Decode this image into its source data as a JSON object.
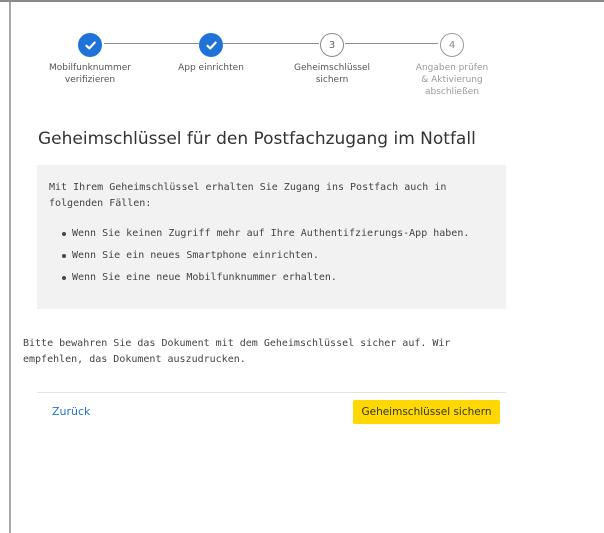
{
  "stepper": {
    "steps": [
      {
        "number": "",
        "status": "completed",
        "label_line1": "Mobilfunknummer",
        "label_line2": "verifizieren",
        "label_line3": ""
      },
      {
        "number": "",
        "status": "completed",
        "label_line1": "App einrichten",
        "label_line2": "",
        "label_line3": ""
      },
      {
        "number": "3",
        "status": "current",
        "label_line1": "Geheimschlüssel",
        "label_line2": "sichern",
        "label_line3": ""
      },
      {
        "number": "4",
        "status": "upcoming",
        "label_line1": "Angaben prüfen",
        "label_line2": "& Aktivierung",
        "label_line3": "abschließen"
      }
    ],
    "colors": {
      "completed": "#1f73d8",
      "line": "#8e8e8e"
    }
  },
  "main": {
    "title": "Geheimschlüssel für den Postfachzugang im Notfall",
    "info": {
      "intro": "Mit Ihrem Geheimschlüssel erhalten Sie Zugang ins Postfach auch in folgenden Fällen:",
      "items": [
        "Wenn Sie keinen Zugriff mehr auf Ihre Authentifzierungs-App haben.",
        "Wenn Sie ein neues Smartphone einrichten.",
        "Wenn Sie eine neue Mobilfunknummer erhalten."
      ]
    },
    "note": "Bitte bewahren Sie das Dokument mit dem Geheimschlüssel sicher auf. Wir empfehlen, das Dokument auszudrucken."
  },
  "actions": {
    "back_label": "Zurück",
    "save_label": "Geheimschlüssel sichern",
    "accent_color": "#ffd800",
    "link_color": "#1f73d8"
  }
}
